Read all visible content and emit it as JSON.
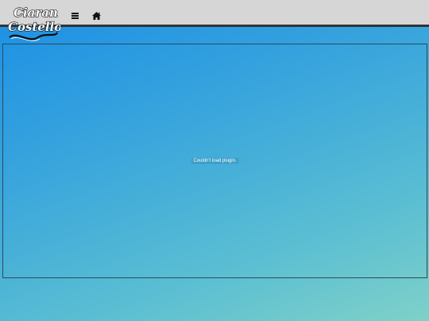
{
  "header": {
    "logo_text": "Ciaran Costello",
    "menu_icon": "menu-icon",
    "home_icon": "home-icon"
  },
  "content": {
    "plugin_message": "Couldn't load plugin."
  },
  "colors": {
    "topbar": "#d6d6d6",
    "topbar_border": "#333333",
    "gradient_start": "#1a8ee6",
    "gradient_end": "#7fd1c8"
  }
}
